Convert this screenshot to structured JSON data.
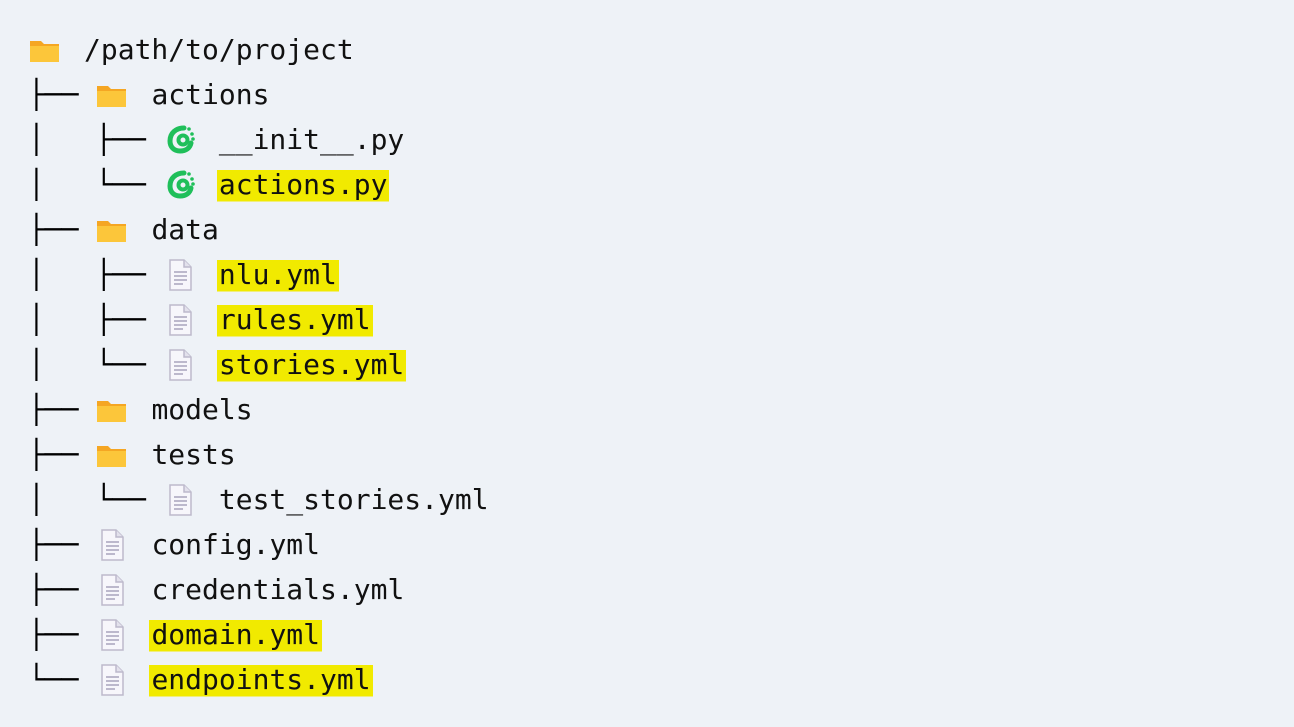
{
  "tree": {
    "root": {
      "label": "/path/to/project",
      "icon": "folder-icon"
    },
    "rows": [
      {
        "prefix": "├── ",
        "label": "actions",
        "icon": "folder-icon",
        "highlighted": false
      },
      {
        "prefix": "│   ├── ",
        "label": "__init__.py",
        "icon": "python-file-icon",
        "highlighted": false
      },
      {
        "prefix": "│   └── ",
        "label": "actions.py",
        "icon": "python-file-icon",
        "highlighted": true
      },
      {
        "prefix": "├── ",
        "label": "data",
        "icon": "folder-icon",
        "highlighted": false
      },
      {
        "prefix": "│   ├── ",
        "label": "nlu.yml",
        "icon": "document-icon",
        "highlighted": true
      },
      {
        "prefix": "│   ├── ",
        "label": "rules.yml",
        "icon": "document-icon",
        "highlighted": true
      },
      {
        "prefix": "│   └── ",
        "label": "stories.yml",
        "icon": "document-icon",
        "highlighted": true
      },
      {
        "prefix": "├── ",
        "label": "models",
        "icon": "folder-icon",
        "highlighted": false
      },
      {
        "prefix": "├── ",
        "label": "tests",
        "icon": "folder-icon",
        "highlighted": false
      },
      {
        "prefix": "│   └── ",
        "label": "test_stories.yml",
        "icon": "document-icon",
        "highlighted": false
      },
      {
        "prefix": "├── ",
        "label": "config.yml",
        "icon": "document-icon",
        "highlighted": false
      },
      {
        "prefix": "├── ",
        "label": "credentials.yml",
        "icon": "document-icon",
        "highlighted": false
      },
      {
        "prefix": "├── ",
        "label": "domain.yml",
        "icon": "document-icon",
        "highlighted": true
      },
      {
        "prefix": "└── ",
        "label": "endpoints.yml",
        "icon": "document-icon",
        "highlighted": true
      }
    ]
  },
  "colors": {
    "background": "#eef2f7",
    "highlight": "#f1ea00",
    "folder": "#f9c23c",
    "python": "#21c55d",
    "document": "#c9c7d6"
  }
}
